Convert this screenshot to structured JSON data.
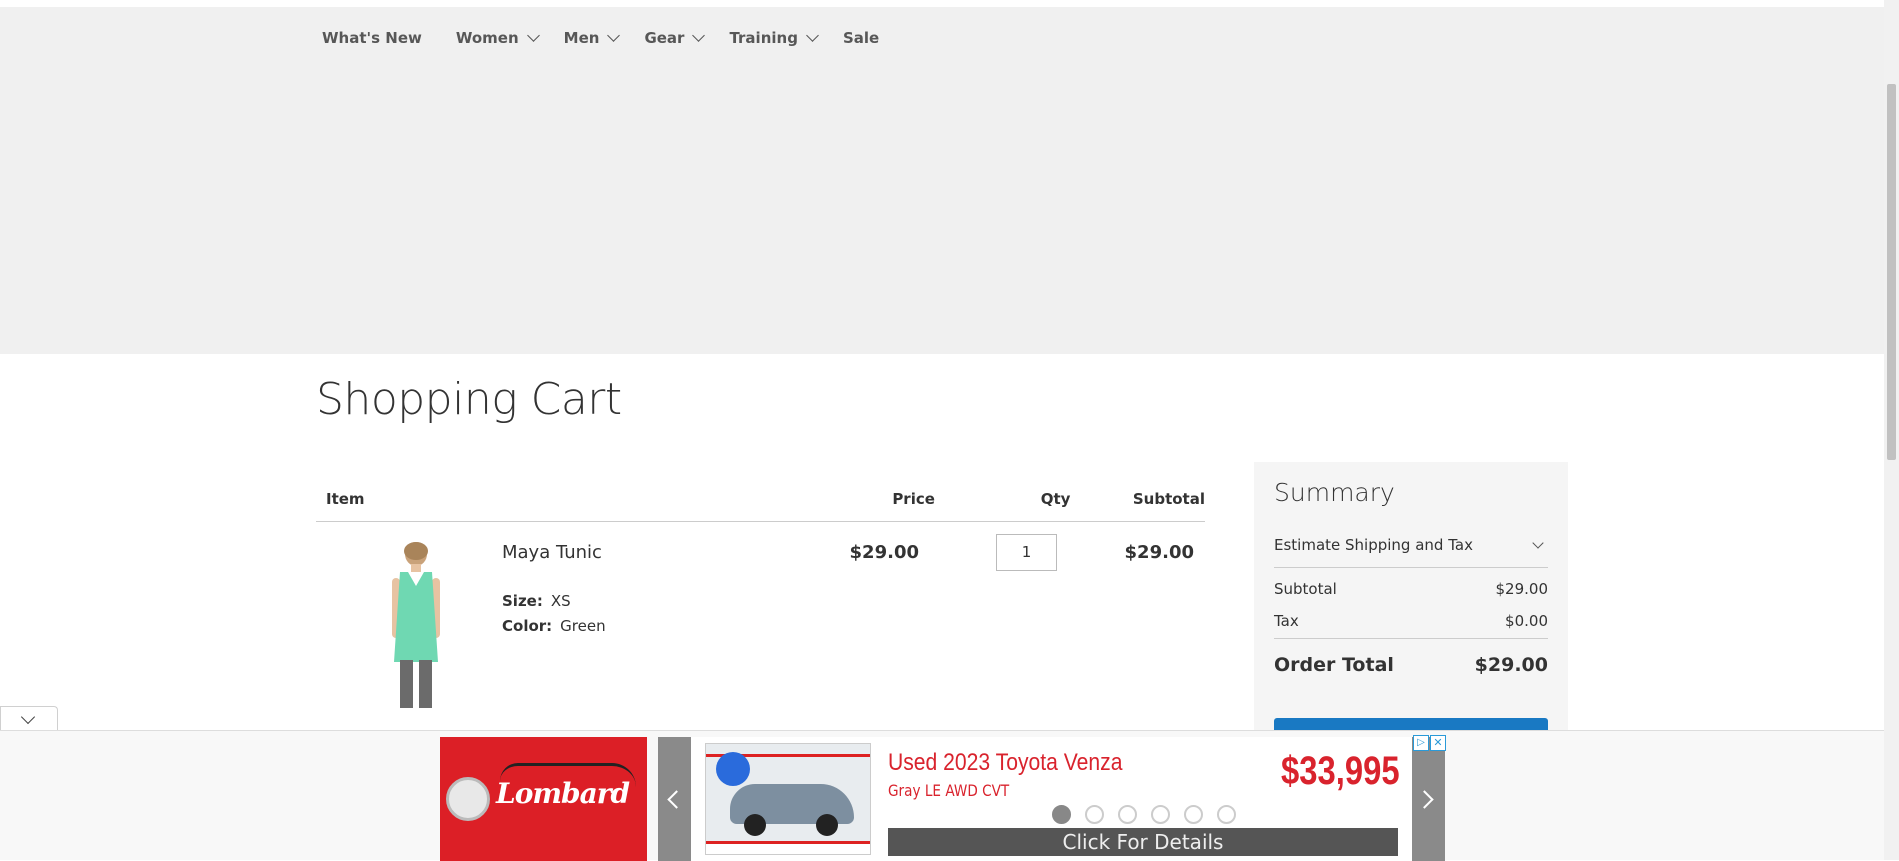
{
  "nav": {
    "items": [
      {
        "label": "What's New",
        "has_submenu": false
      },
      {
        "label": "Women",
        "has_submenu": true
      },
      {
        "label": "Men",
        "has_submenu": true
      },
      {
        "label": "Gear",
        "has_submenu": true
      },
      {
        "label": "Training",
        "has_submenu": true
      },
      {
        "label": "Sale",
        "has_submenu": false
      }
    ]
  },
  "page": {
    "title": "Shopping Cart"
  },
  "cart": {
    "headers": {
      "item": "Item",
      "price": "Price",
      "qty": "Qty",
      "subtotal": "Subtotal"
    },
    "items": [
      {
        "name": "Maya Tunic",
        "size_label": "Size:",
        "size": "XS",
        "color_label": "Color:",
        "color": "Green",
        "price": "$29.00",
        "qty": "1",
        "subtotal": "$29.00",
        "image_color": "#6fd8b2"
      }
    ]
  },
  "summary": {
    "title": "Summary",
    "estimate_label": "Estimate Shipping and Tax",
    "subtotal_label": "Subtotal",
    "subtotal_value": "$29.00",
    "tax_label": "Tax",
    "tax_value": "$0.00",
    "order_total_label": "Order Total",
    "order_total_value": "$29.00",
    "checkout_color": "#1979c3"
  },
  "ad": {
    "brand": "Lombard",
    "title": "Used 2023 Toyota Venza",
    "subtitle": "Gray LE AWD CVT",
    "price": "$33,995",
    "cta": "Click For Details",
    "info_icon": "adchoices-icon",
    "close_icon": "close-icon",
    "slide_count": 6,
    "active_slide": 0,
    "accent": "#d9232d"
  }
}
